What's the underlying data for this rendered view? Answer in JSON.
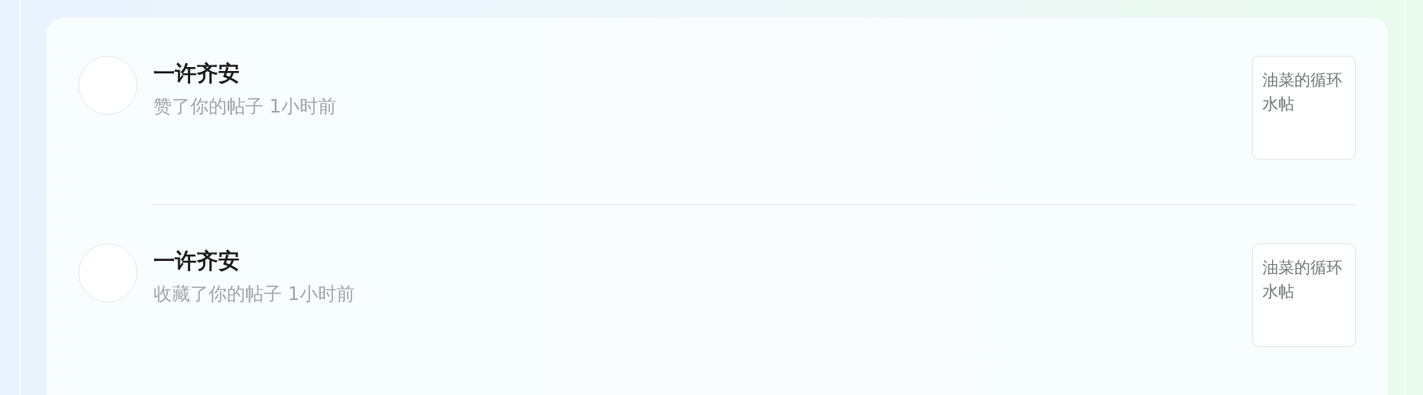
{
  "notifications": [
    {
      "user": "一许齐安",
      "action": "赞了你的帖子",
      "time": "1小时前",
      "post_title": "油菜的循环水帖"
    },
    {
      "user": "一许齐安",
      "action": "收藏了你的帖子",
      "time": "1小时前",
      "post_title": "油菜的循环水帖"
    }
  ]
}
